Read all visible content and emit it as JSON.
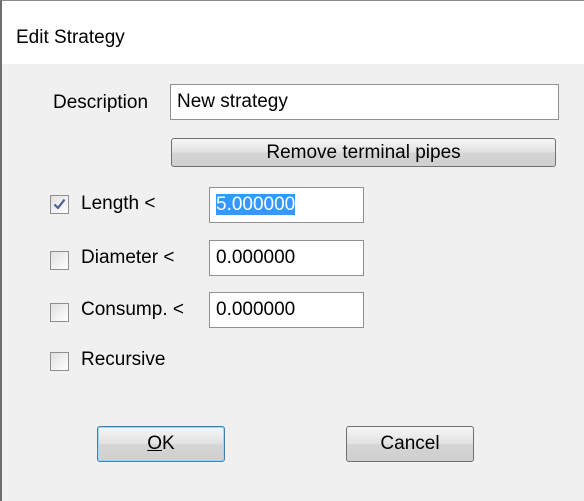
{
  "window": {
    "title": "Edit Strategy"
  },
  "form": {
    "description_label": "Description",
    "description_value": "New strategy",
    "remove_button_label": "Remove terminal pipes",
    "length": {
      "checked": true,
      "label": "Length <",
      "value": "5.000000"
    },
    "diameter": {
      "checked": false,
      "label": "Diameter <",
      "value": "0.000000"
    },
    "consumption": {
      "checked": false,
      "label": "Consump. <",
      "value": "0.000000"
    },
    "recursive": {
      "checked": false,
      "label": "Recursive"
    }
  },
  "buttons": {
    "ok_mnemonic": "O",
    "ok_rest": "K",
    "cancel_label": "Cancel"
  },
  "colors": {
    "selection": "#3399ff",
    "check_mark": "#4a5f97"
  }
}
